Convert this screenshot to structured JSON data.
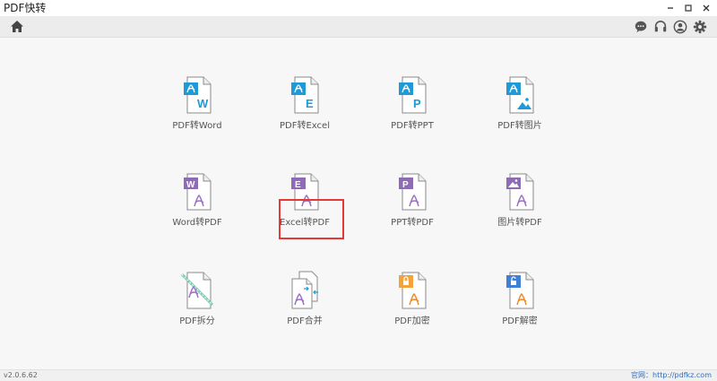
{
  "window": {
    "title": "PDF快转"
  },
  "toolbar": {
    "home_icon": "home-icon",
    "right_icons": [
      "chat-icon",
      "headset-icon",
      "user-icon",
      "gear-icon"
    ]
  },
  "colors": {
    "pdf_to_x_header": "#1e9ad6",
    "x_to_pdf_header": "#8e6bb5",
    "split_band": "#7fc9b6",
    "encrypt_header": "#f5a23a",
    "decrypt_header": "#3f7fd6",
    "adobe_red_blue": "#1e9ad6",
    "adobe_purple": "#9b6fc7",
    "adobe_orange": "#f08a24",
    "highlight": "#e53935"
  },
  "tiles": {
    "pdf_to_word": {
      "label": "PDF转Word",
      "letter": "W"
    },
    "pdf_to_excel": {
      "label": "PDF转Excel",
      "letter": "E"
    },
    "pdf_to_ppt": {
      "label": "PDF转PPT",
      "letter": "P"
    },
    "pdf_to_image": {
      "label": "PDF转图片"
    },
    "word_to_pdf": {
      "label": "Word转PDF",
      "letter": "W"
    },
    "excel_to_pdf": {
      "label": "Excel转PDF",
      "letter": "E"
    },
    "ppt_to_pdf": {
      "label": "PPT转PDF",
      "letter": "P"
    },
    "image_to_pdf": {
      "label": "图片转PDF"
    },
    "pdf_split": {
      "label": "PDF拆分"
    },
    "pdf_merge": {
      "label": "PDF合并"
    },
    "pdf_encrypt": {
      "label": "PDF加密"
    },
    "pdf_decrypt": {
      "label": "PDF解密"
    }
  },
  "status": {
    "version": "v2.0.6.62",
    "website": "官网：http://pdfkz.com"
  }
}
